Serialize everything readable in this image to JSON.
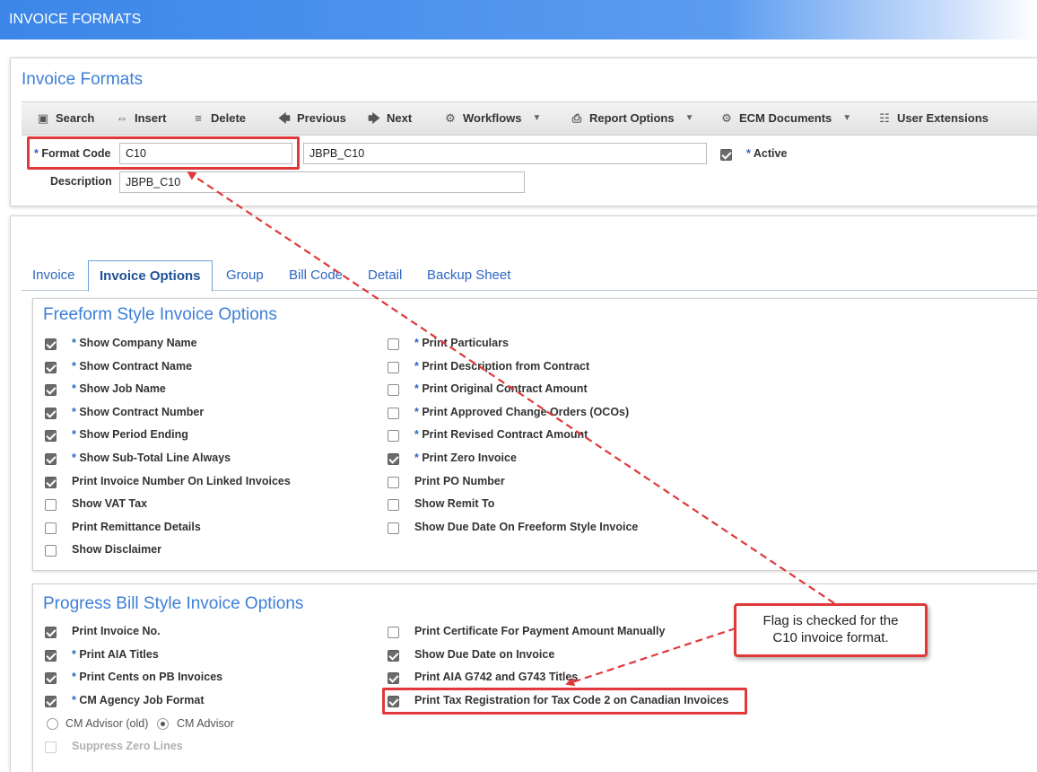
{
  "window": {
    "title": "INVOICE FORMATS"
  },
  "form": {
    "title": "Invoice Formats"
  },
  "toolbar": {
    "search": "Search",
    "insert": "Insert",
    "delete": "Delete",
    "previous": "Previous",
    "next": "Next",
    "workflows": "Workflows",
    "report_options": "Report Options",
    "ecm_documents": "ECM Documents",
    "user_extensions": "User Extensions"
  },
  "header_fields": {
    "format_code_label": "Format Code",
    "format_code_value": "C10",
    "format_name_value": "JBPB_C10",
    "active_label": "Active",
    "active_checked": true,
    "description_label": "Description",
    "description_value": "JBPB_C10"
  },
  "tabs": [
    {
      "label": "Invoice",
      "active": false
    },
    {
      "label": "Invoice Options",
      "active": true
    },
    {
      "label": "Group",
      "active": false
    },
    {
      "label": "Bill Code",
      "active": false
    },
    {
      "label": "Detail",
      "active": false
    },
    {
      "label": "Backup Sheet",
      "active": false
    }
  ],
  "freeform": {
    "title": "Freeform Style Invoice Options",
    "left": [
      {
        "label": "Show Company Name",
        "required": true,
        "checked": true
      },
      {
        "label": "Show Contract Name",
        "required": true,
        "checked": true
      },
      {
        "label": "Show Job Name",
        "required": true,
        "checked": true
      },
      {
        "label": "Show Contract Number",
        "required": true,
        "checked": true
      },
      {
        "label": "Show Period Ending",
        "required": true,
        "checked": true
      },
      {
        "label": "Show Sub-Total Line Always",
        "required": true,
        "checked": true
      },
      {
        "label": "Print Invoice Number On Linked Invoices",
        "required": false,
        "checked": true
      },
      {
        "label": "Show VAT Tax",
        "required": false,
        "checked": false
      },
      {
        "label": "Print Remittance Details",
        "required": false,
        "checked": false
      },
      {
        "label": "Show Disclaimer",
        "required": false,
        "checked": false
      }
    ],
    "right": [
      {
        "label": "Print Particulars",
        "required": true,
        "checked": false
      },
      {
        "label": "Print Description from Contract",
        "required": true,
        "checked": false
      },
      {
        "label": "Print Original Contract Amount",
        "required": true,
        "checked": false
      },
      {
        "label": "Print Approved Change Orders (OCOs)",
        "required": true,
        "checked": false
      },
      {
        "label": "Print Revised Contract Amount",
        "required": true,
        "checked": false
      },
      {
        "label": "Print Zero Invoice",
        "required": true,
        "checked": true
      },
      {
        "label": "Print PO Number",
        "required": false,
        "checked": false
      },
      {
        "label": "Show Remit To",
        "required": false,
        "checked": false
      },
      {
        "label": "Show Due Date On Freeform Style Invoice",
        "required": false,
        "checked": false
      }
    ]
  },
  "progress": {
    "title": "Progress Bill Style Invoice Options",
    "left": [
      {
        "label": "Print Invoice No.",
        "required": false,
        "checked": true
      },
      {
        "label": "Print AIA Titles",
        "required": true,
        "checked": true
      },
      {
        "label": "Print Cents on PB Invoices",
        "required": true,
        "checked": true
      },
      {
        "label": "CM Agency Job Format",
        "required": true,
        "checked": true
      }
    ],
    "right": [
      {
        "label": "Print Certificate For Payment Amount Manually",
        "required": false,
        "checked": false
      },
      {
        "label": "Show Due Date on Invoice",
        "required": false,
        "checked": true
      },
      {
        "label": "Print AIA G742 and G743 Titles",
        "required": false,
        "checked": true
      },
      {
        "label": "Print Tax Registration for Tax Code 2 on Canadian Invoices",
        "required": false,
        "checked": true
      }
    ],
    "radio_old": "CM Advisor (old)",
    "radio_new": "CM Advisor",
    "suppress_zero_lines": "Suppress Zero Lines"
  },
  "callout": {
    "line1": "Flag is checked for the",
    "line2": "C10 invoice format."
  },
  "colors": {
    "title_bar": "#3b86e8",
    "highlight": "#e0383b",
    "link": "#2d66c2"
  }
}
